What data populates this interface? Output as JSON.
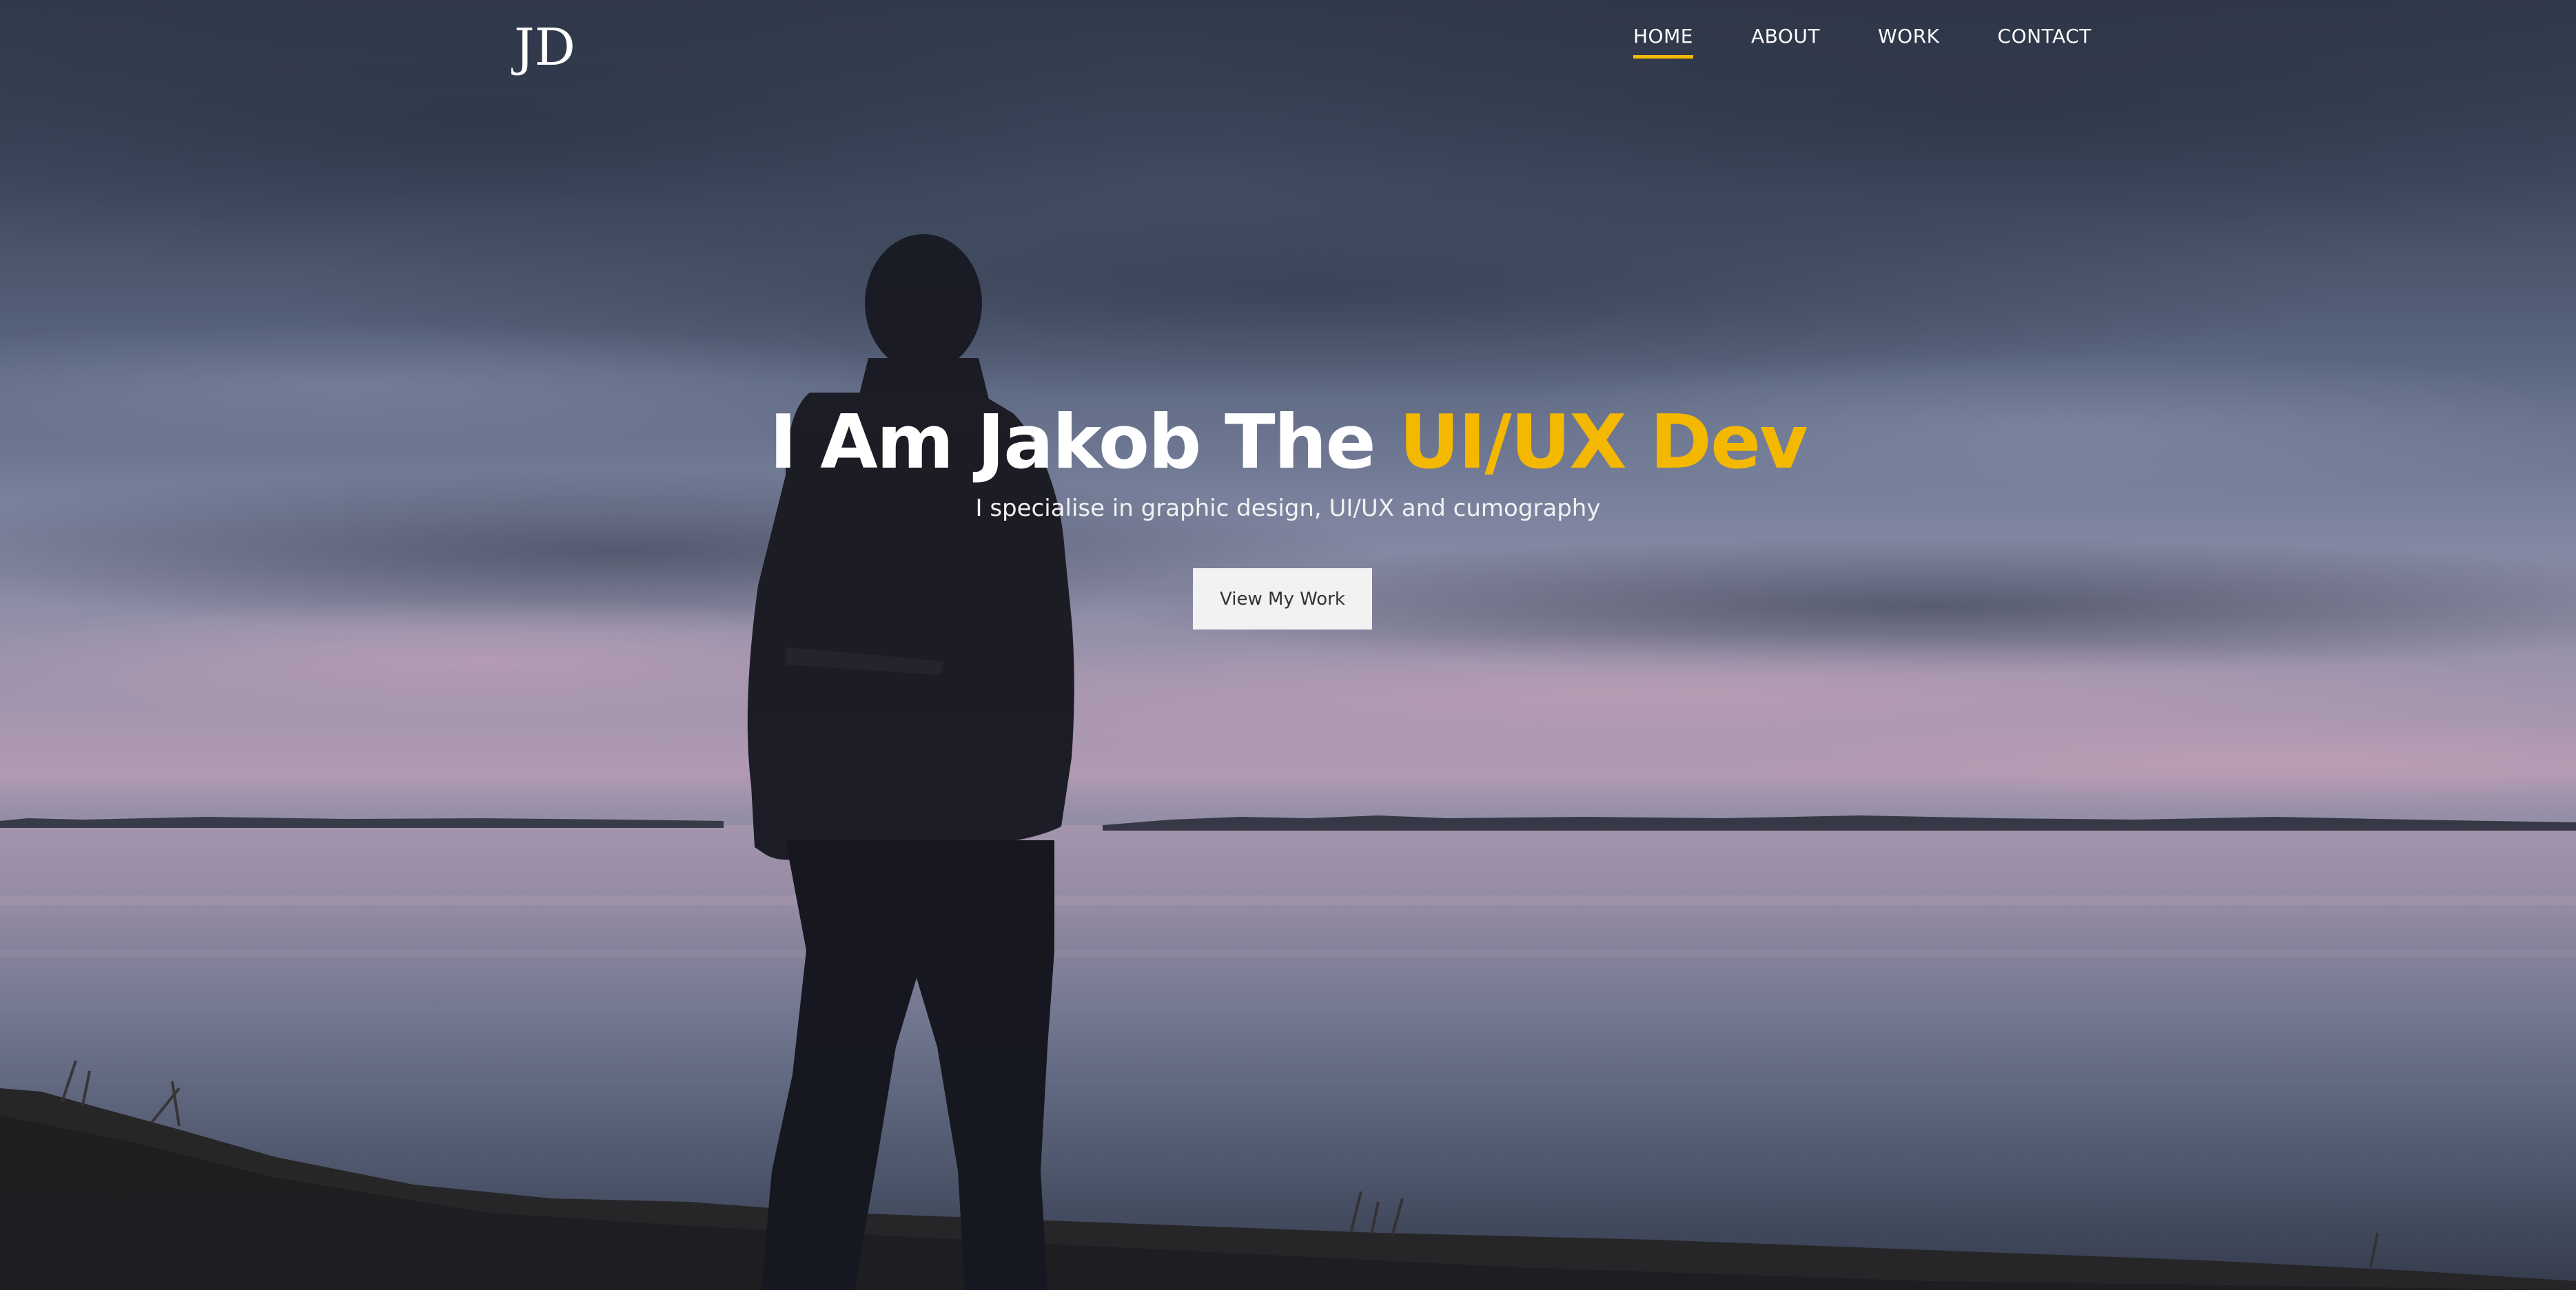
{
  "brand": {
    "logo_text": "JD"
  },
  "nav": {
    "items": [
      {
        "label": "HOME",
        "active": true
      },
      {
        "label": "ABOUT",
        "active": false
      },
      {
        "label": "WORK",
        "active": false
      },
      {
        "label": "CONTACT",
        "active": false
      }
    ]
  },
  "hero": {
    "headline_prefix": "I Am Jakob The",
    "headline_accent": "UI/UX Dev",
    "subline": "I specialise in graphic design, UI/UX and cumography",
    "cta_label": "View My Work"
  },
  "colors": {
    "accent": "#f5b800",
    "button_bg": "#f2f2f2",
    "button_text": "#333333",
    "text": "#ffffff"
  }
}
